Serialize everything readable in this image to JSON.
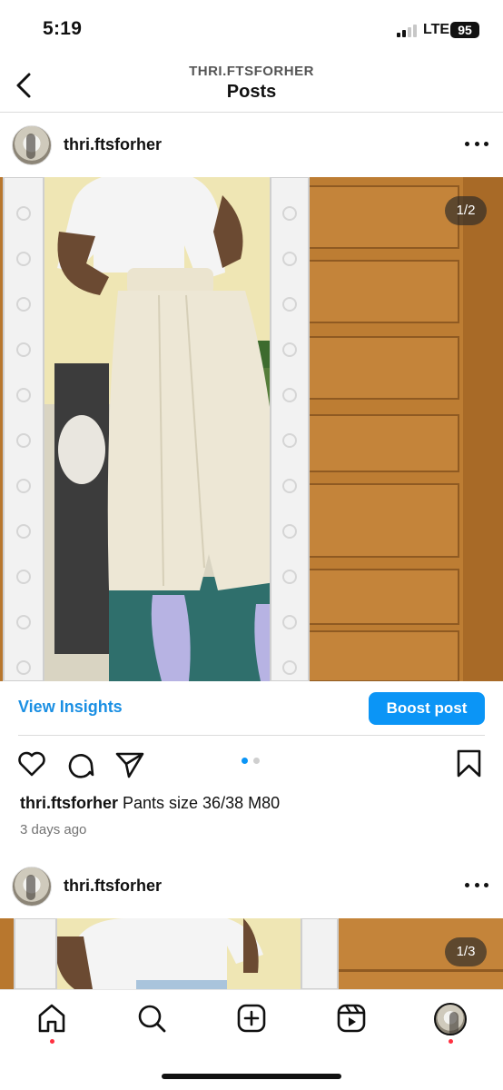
{
  "status_bar": {
    "time": "5:19",
    "network": "LTE",
    "battery": "95"
  },
  "header": {
    "account": "THRI.FTSFORHER",
    "title": "Posts"
  },
  "posts": [
    {
      "username": "thri.ftsforher",
      "photo_counter": "1/2"
    },
    {
      "username": "thri.ftsforher",
      "photo_counter": "1/3"
    }
  ],
  "insights": {
    "view_label": "View Insights",
    "boost_label": "Boost post"
  },
  "caption": {
    "username": "thri.ftsforher",
    "text": " Pants size 36/38 M80",
    "time_ago": "3 days ago"
  },
  "carousel": {
    "total": 2,
    "active": 1
  },
  "icons": {
    "back": "chevron-left-icon",
    "more": "more-horizontal-icon",
    "like": "heart-icon",
    "comment": "comment-icon",
    "share": "send-icon",
    "save": "bookmark-icon",
    "home": "home-icon",
    "search": "search-icon",
    "create": "plus-square-icon",
    "reels": "reels-icon",
    "profile": "avatar"
  },
  "colors": {
    "accent": "#0b95f6",
    "link": "#1a8fe3",
    "notification": "#ff3040"
  }
}
